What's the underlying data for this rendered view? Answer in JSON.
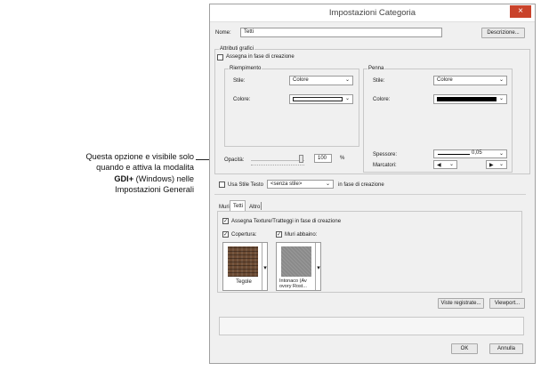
{
  "annotation": {
    "line1": "Questa opzione e visibile solo",
    "line2": "quando e attiva la modalita",
    "line3_bold": "GDI+",
    "line3_rest": " (Windows) nelle",
    "line4": "Impostazioni Generali"
  },
  "window": {
    "title": "Impostazioni Categoria",
    "close_glyph": "×"
  },
  "name_row": {
    "label": "Nome:",
    "value": "Tetti",
    "description_button": "Descrizione..."
  },
  "attributes": {
    "group_title": "Attributi grafici",
    "assign_on_create": "Assegna in fase di creazione",
    "fill": {
      "title": "Riempimento",
      "style_label": "Stile:",
      "style_value": "Colore",
      "color_label": "Colore:"
    },
    "pen": {
      "title": "Penna",
      "style_label": "Stile:",
      "style_value": "Colore",
      "color_label": "Colore:",
      "thickness_label": "Spessore:",
      "thickness_value": "0,05",
      "markers_label": "Marcatori:",
      "marker_left": "◀",
      "marker_right": "▶"
    },
    "opacity": {
      "label": "Opacità:",
      "value": "100",
      "unit": "%",
      "level": 1.0
    }
  },
  "text_style": {
    "checkbox_label": "Usa Stile Testo",
    "value": "<senza stile>",
    "suffix": "in fase di creazione"
  },
  "tabs": [
    {
      "label": "Muri"
    },
    {
      "label": "Tetti"
    },
    {
      "label": "Altro"
    }
  ],
  "tab_content": {
    "assign_textures": "Assegna Texture/Tratteggi in fase di creazione",
    "coverage": {
      "label": "Copertura:",
      "texture_name": "Tegole",
      "texture_color": "#6b4a32"
    },
    "walls_below": {
      "label": "Muri abbaino:",
      "texture_name": "Intonaco (Av ovory Rost...",
      "texture_color": "#8a8a8a"
    }
  },
  "buttons": {
    "saved_views": "Viste registrate...",
    "viewport": "Viewport...",
    "ok": "OK",
    "cancel": "Annulla"
  },
  "colors": {
    "close": "#c9432b",
    "black_swatch": "#000000"
  }
}
